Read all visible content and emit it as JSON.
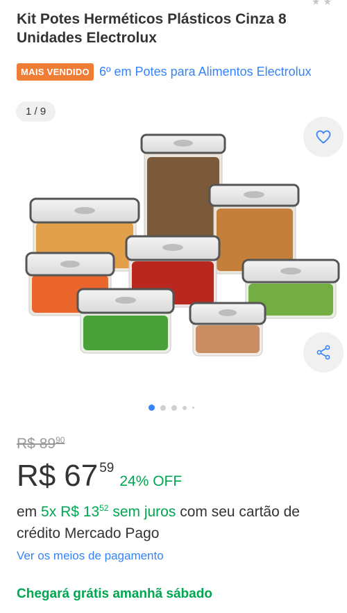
{
  "product": {
    "title": "Kit Potes Herméticos Plásticos Cinza 8 Unidades Electrolux",
    "badge": "MAIS VENDIDO",
    "ranking_link": "6º em Potes para Alimentos Electrolux",
    "image_counter": "1 / 9",
    "icons": {
      "favorite": "heart-icon",
      "share": "share-icon",
      "rating": "star-icon"
    }
  },
  "carousel": {
    "total_dots": 5,
    "active_index": 0
  },
  "pricing": {
    "old_currency": "R$",
    "old_whole": "89",
    "old_cents": "90",
    "currency": "R$",
    "whole": "67",
    "cents": "59",
    "discount": "24% OFF"
  },
  "installments": {
    "prefix": "em",
    "count": "5x",
    "currency": "R$",
    "whole": "13",
    "cents": "52",
    "interest": "sem juros",
    "suffix": "com seu cartão de crédito Mercado Pago"
  },
  "payment_link": "Ver os meios de pagamento",
  "shipping": "Chegará grátis amanhã sábado",
  "colors": {
    "accent_blue": "#3483fa",
    "success_green": "#00a650",
    "badge_orange": "#f07d35"
  }
}
